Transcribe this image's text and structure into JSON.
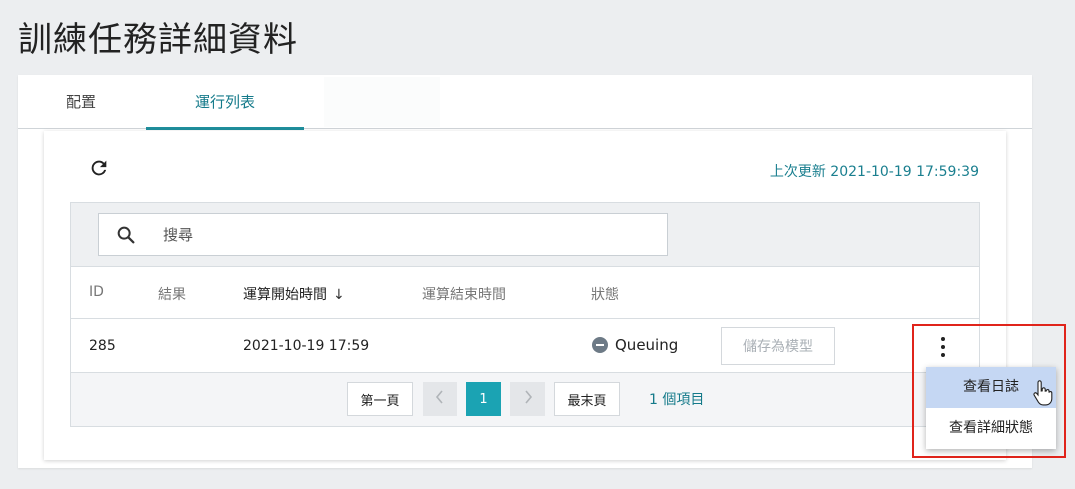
{
  "page": {
    "title": "訓練任務詳細資料"
  },
  "tabs": [
    {
      "label": "配置"
    },
    {
      "label": "運行列表"
    }
  ],
  "toolbar": {
    "last_updated": "上次更新 2021-10-19 17:59:39",
    "refresh_icon": "refresh-icon"
  },
  "search": {
    "placeholder": "搜尋",
    "icon": "search-icon"
  },
  "table": {
    "columns": [
      "ID",
      "結果",
      "運算開始時間",
      "運算結束時間",
      "狀態"
    ],
    "sorted_column": "運算開始時間",
    "sort_direction": "descending",
    "rows": [
      {
        "id": "285",
        "result": "",
        "start_time": "2021-10-19 17:59",
        "end_time": "",
        "status": "Queuing",
        "action_label": "儲存為模型"
      }
    ]
  },
  "pagination": {
    "first": "第一頁",
    "current": "1",
    "last": "最末頁",
    "count": "1 個項目"
  },
  "row_menu": {
    "items": [
      "查看日誌",
      "查看詳細狀態"
    ]
  },
  "colors": {
    "accent": "#1ba3b3",
    "link": "#147a8a",
    "highlight": "#e0241b",
    "menu_hover": "#c5d7f3"
  }
}
